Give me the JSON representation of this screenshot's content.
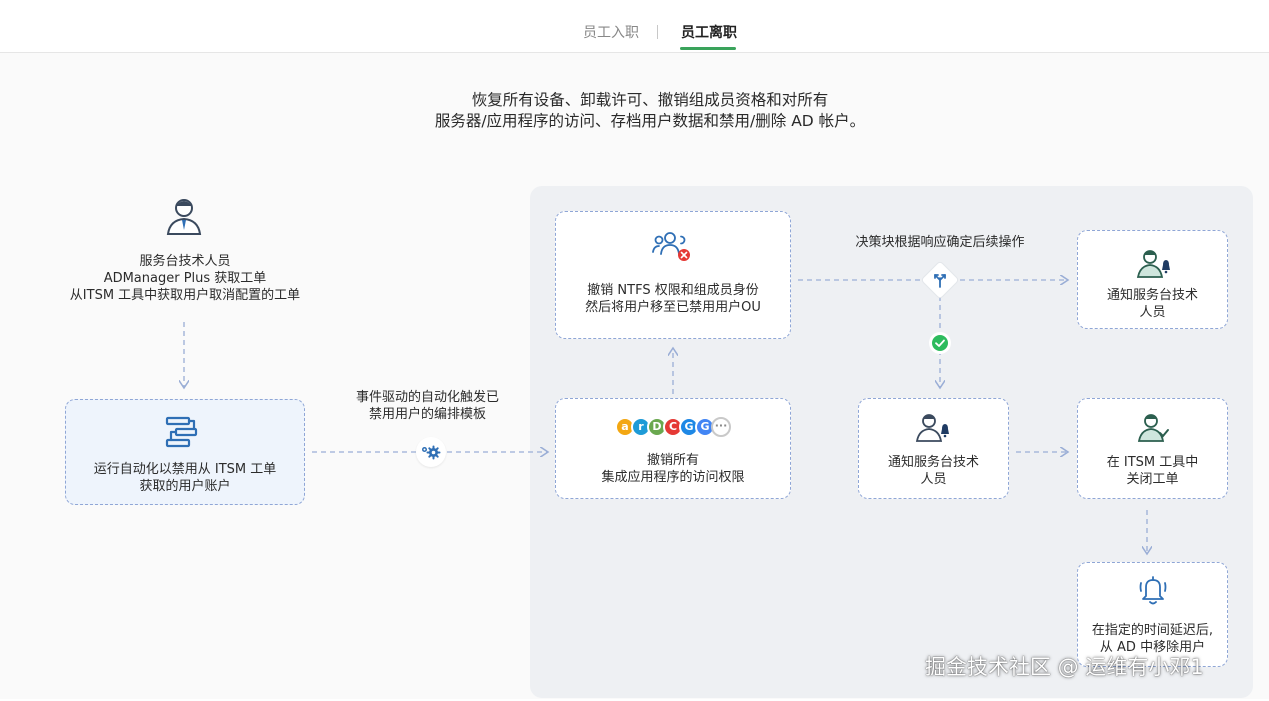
{
  "tabs": [
    {
      "label": "员工入职",
      "active": false
    },
    {
      "label": "员工离职",
      "active": true
    }
  ],
  "heading": {
    "line1": "恢复所有设备、卸载许可、撤销组成员资格和对所有",
    "line2": "服务器/应用程序的访问、存档用户数据和禁用/删除 AD 帐户。"
  },
  "start": {
    "icon": "technician-icon",
    "lines": [
      "服务台技术人员",
      "ADManager Plus 获取工单",
      "从ITSM 工具中获取用户取消配置的工单"
    ]
  },
  "run_box": {
    "icon": "workflow-icon",
    "lines": [
      "运行自动化以禁用从 ITSM 工单",
      "获取的用户账户"
    ]
  },
  "trigger_label": {
    "icon": "gear-icon",
    "lines": [
      "事件驱动的自动化触发已",
      "禁用用户的编排模板"
    ]
  },
  "revoke_ntfs": {
    "icon": "users-revoke-icon",
    "lines": [
      "撤销 NTFS 权限和组成员身份",
      "然后将用户移至已禁用用户OU"
    ]
  },
  "revoke_apps": {
    "icon": "app-logos-icon",
    "app_icon_colors": [
      "#f3a712",
      "#1e9bd7",
      "#6aa84f",
      "#e53935",
      "#1e88e5",
      "#4285f4"
    ],
    "lines": [
      "撤销所有",
      "集成应用程序的访问权限"
    ]
  },
  "decision": {
    "icon": "decision-icon",
    "label": "决策块根据响应确定后续操作",
    "check_icon": "check-icon"
  },
  "notify_top": {
    "icon": "technician-bell-icon",
    "lines": [
      "通知服务台技术",
      "人员"
    ]
  },
  "notify_mid": {
    "icon": "technician-bell-icon",
    "lines": [
      "通知服务台技术",
      "人员"
    ]
  },
  "close_ticket": {
    "icon": "technician-check-icon",
    "lines": [
      "在 ITSM 工具中",
      "关闭工单"
    ]
  },
  "remove_user": {
    "icon": "bell-icon",
    "lines": [
      "在指定的时间延迟后,",
      "从 AD 中移除用户"
    ]
  },
  "watermark": "掘金技术社区 @ 运维有小邓1",
  "colors": {
    "accent_green": "#3aa35b",
    "dashed_border": "#8fa6d6",
    "icon_blue": "#2f6fb5",
    "error_red": "#e53935",
    "success_green": "#2dbb5d"
  }
}
